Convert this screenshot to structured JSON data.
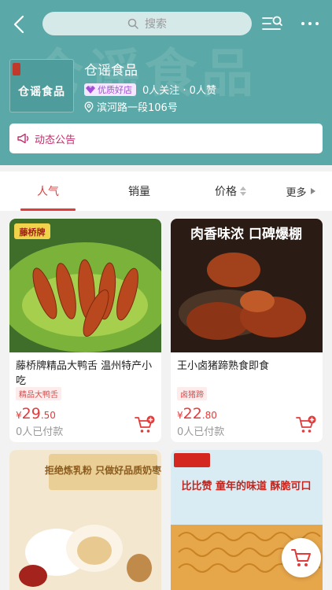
{
  "header": {
    "search_placeholder": "搜索"
  },
  "shop": {
    "watermark": "仓谣食品",
    "logo_text": "仓谣食品",
    "name": "仓谣食品",
    "badge": "优质好店",
    "follow_stats": "0人关注 · 0人赞",
    "address": "滨河路一段106号",
    "notice": "动态公告"
  },
  "tabs": {
    "popular": "人气",
    "sales": "销量",
    "price": "价格",
    "more": "更多"
  },
  "products": [
    {
      "title": "藤桥牌精品大鸭舌 温州特产小吃",
      "tag": "精品大鸭舌",
      "price_symbol": "¥",
      "price_int": "29",
      "price_dec": ".50",
      "sold": "0人已付款",
      "image_label": "藤桥牌"
    },
    {
      "title": "王小卤猪蹄熟食即食",
      "tag": "卤猪蹄",
      "price_symbol": "¥",
      "price_int": "22",
      "price_dec": ".80",
      "sold": "0人已付款",
      "image_label": "肉香味浓 口碑爆棚"
    },
    {
      "image_label": "拒绝炼乳粉 只做好品质奶枣"
    },
    {
      "image_label": "比比赞 童年的味道 酥脆可口"
    }
  ],
  "colors": {
    "hero_bg": "#5aa9a8",
    "accent_red": "#e23b3b",
    "notice_pink": "#c62a6b",
    "badge_purple": "#a24ed8"
  }
}
